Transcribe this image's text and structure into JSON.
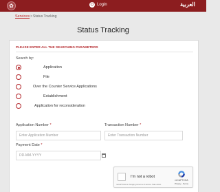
{
  "header": {
    "logo_glyph": "✿",
    "login_icon": "⏻",
    "login_label": "Login",
    "language_label": "العربية"
  },
  "breadcrumb": {
    "services": "Services",
    "separator": ">",
    "current": "Status Tracking"
  },
  "page_title": "Status Tracking",
  "form": {
    "section_heading": "PLEASE ENTER ALL THE SEARCHING PARAMETERS",
    "search_by_label": "Search by:",
    "options": [
      {
        "label": "Application",
        "checked": true
      },
      {
        "label": "File",
        "checked": false
      },
      {
        "label": "Over the Counter Service Applications",
        "checked": false
      },
      {
        "label": "Establishment",
        "checked": false
      },
      {
        "label": "Application for reconsideration",
        "checked": false
      }
    ],
    "application_number": {
      "label": "Application Number",
      "required_mark": "*",
      "placeholder": "Enter Application Number"
    },
    "transaction_number": {
      "label": "Transaction Number",
      "required_mark": "*",
      "placeholder": "Enter Transaction Number"
    },
    "payment_date": {
      "label": "Payment Date",
      "required_mark": "*",
      "placeholder": "DD-MM-YYYY"
    }
  },
  "recaptcha": {
    "checkbox_label": "I'm not a robot",
    "brand": "reCAPTCHA",
    "links": "Privacy - Terms",
    "note": "reCAPTCHA is changing its terms of service. Take action."
  },
  "colors": {
    "brand": "#8c1d1f",
    "accent": "#b3262a",
    "background": "#e9e9e9"
  }
}
